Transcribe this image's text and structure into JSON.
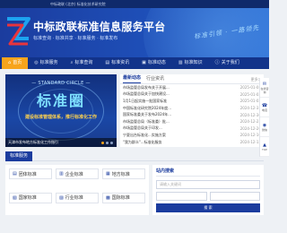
{
  "topbar": {
    "text": "中标政联 (北京) 标准化技术研究院"
  },
  "header": {
    "title": "中标政联标准信息服务平台",
    "subtitle": "标准查询 · 标准共享 · 标准服务 · 标准发布",
    "slogan": "标准引领 · 一路领先"
  },
  "nav": [
    {
      "label": "首页",
      "icon": "home-icon",
      "glyph": "⌂"
    },
    {
      "label": "标准服务",
      "icon": "service-icon",
      "glyph": "◎"
    },
    {
      "label": "标准查询",
      "icon": "search-icon",
      "glyph": "⌕"
    },
    {
      "label": "标准资讯",
      "icon": "news-icon",
      "glyph": "▤"
    },
    {
      "label": "标准动态",
      "icon": "dynamic-icon",
      "glyph": "▣"
    },
    {
      "label": "标准知识",
      "icon": "knowledge-icon",
      "glyph": "▥"
    },
    {
      "label": "关于我们",
      "icon": "about-icon",
      "glyph": "ⓘ"
    }
  ],
  "banner": {
    "english": "— STANDARD CIRCLE —",
    "big": "标准圈",
    "slogan": "建设标准管理体系，推行标准化工作",
    "caption": "天津市发布地方标准化工作指引"
  },
  "news": {
    "tabs": [
      "最新动态",
      "行业资讯"
    ],
    "more": "更多>",
    "items": [
      {
        "title": "市场监管总局发布关于开展...",
        "date": "2025-01-08"
      },
      {
        "title": "市场监管总局关于加快建设...",
        "date": "2025-01-02"
      },
      {
        "title": "1月1日起实施一批国家标准",
        "date": "2025-01-02"
      },
      {
        "title": "中国标准化研究院2024年度...",
        "date": "2024-12-31"
      },
      {
        "title": "国家标准委关于发布2024年...",
        "date": "2024-12-30"
      },
      {
        "title": "市场监管总局（标准委）批...",
        "date": "2024-12-23"
      },
      {
        "title": "市场监管总局关于印发...",
        "date": "2024-12-20"
      },
      {
        "title": "宁夏出台标准化...实施方案",
        "date": "2024-12-16"
      },
      {
        "title": "\"我为群众\"...标准化服务",
        "date": "2024-12-13"
      }
    ]
  },
  "side": [
    {
      "label": "在线咨询",
      "glyph": "✉"
    },
    {
      "label": "电话",
      "glyph": "☎"
    },
    {
      "label": "微信",
      "glyph": "◉"
    },
    {
      "label": "TOP",
      "glyph": "▲"
    }
  ],
  "section": {
    "title": "标准服务"
  },
  "categories": [
    {
      "label": "团体标准",
      "glyph": "▤"
    },
    {
      "label": "企业标准",
      "glyph": "▥"
    },
    {
      "label": "地方标准",
      "glyph": "▦"
    },
    {
      "label": "国家标准",
      "glyph": "▧"
    },
    {
      "label": "行业标准",
      "glyph": "▨"
    },
    {
      "label": "国际标准",
      "glyph": "▩"
    }
  ],
  "search": {
    "title": "站内搜索",
    "placeholder": "请输入关键词",
    "button": "搜 索"
  }
}
